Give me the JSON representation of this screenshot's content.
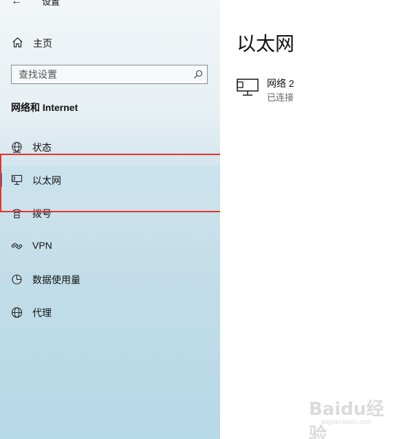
{
  "window": {
    "app_title": "设置",
    "back_icon": "back-arrow-icon"
  },
  "sidebar": {
    "home_label": "主页",
    "home_icon": "home-icon",
    "search_placeholder": "查找设置",
    "search_icon": "search-icon",
    "section_title": "网络和 Internet",
    "items": [
      {
        "label": "状态",
        "icon": "globe-status-icon",
        "selected": false
      },
      {
        "label": "以太网",
        "icon": "ethernet-icon",
        "selected": true
      },
      {
        "label": "拨号",
        "icon": "dialup-icon",
        "selected": false
      },
      {
        "label": "VPN",
        "icon": "vpn-icon",
        "selected": false
      },
      {
        "label": "数据使用量",
        "icon": "data-usage-icon",
        "selected": false
      },
      {
        "label": "代理",
        "icon": "globe-proxy-icon",
        "selected": false
      }
    ],
    "accent_color": "#2a6fc9",
    "annotation_color": "#e9302a"
  },
  "main": {
    "heading": "以太网",
    "network": {
      "name": "网络  2",
      "status": "已连接",
      "icon": "ethernet-network-icon"
    }
  },
  "watermark": {
    "brand": "Baidu经验",
    "site": "jingyan.baidu.com"
  }
}
